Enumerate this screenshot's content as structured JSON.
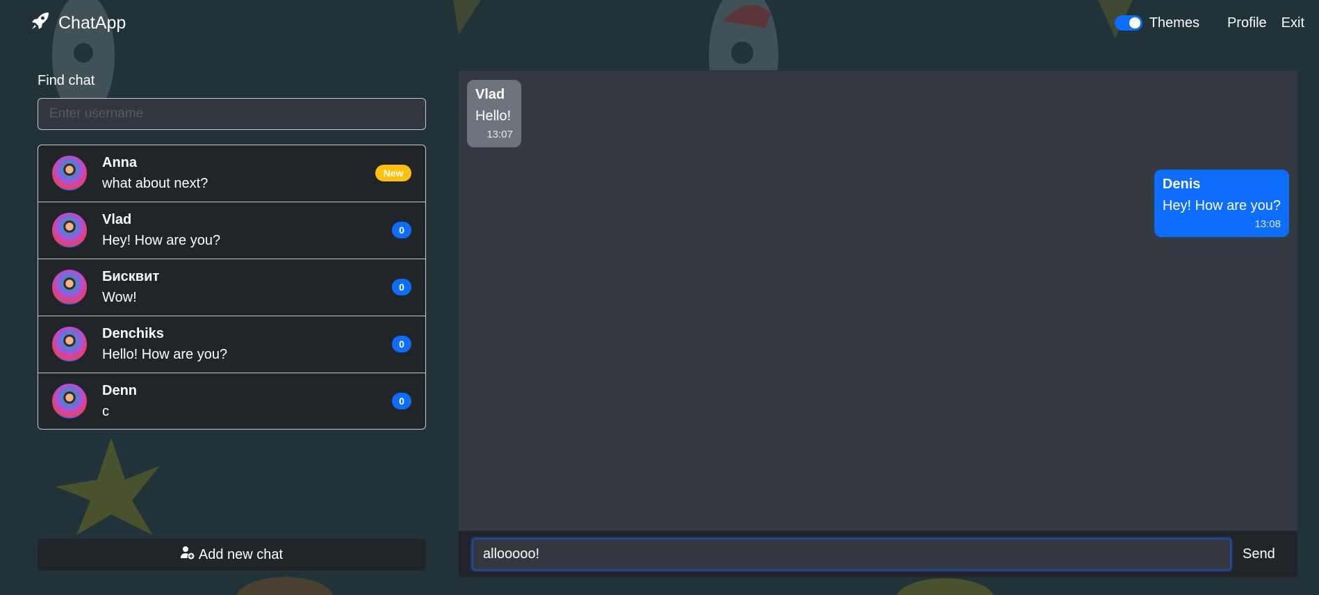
{
  "app": {
    "title": "ChatApp",
    "logo_icon": "rocket-icon"
  },
  "nav": {
    "themes_label": "Themes",
    "themes_on": true,
    "profile_label": "Profile",
    "exit_label": "Exit"
  },
  "sidebar": {
    "find_label": "Find chat",
    "search_placeholder": "Enter username",
    "chats": [
      {
        "name": "Anna",
        "preview": "what about next?",
        "badge": "New",
        "badge_type": "new"
      },
      {
        "name": "Vlad",
        "preview": "Hey! How are you?",
        "badge": "0",
        "badge_type": "count"
      },
      {
        "name": "Бисквит",
        "preview": "Wow!",
        "badge": "0",
        "badge_type": "count"
      },
      {
        "name": "Denchiks",
        "preview": "Hello! How are you?",
        "badge": "0",
        "badge_type": "count"
      },
      {
        "name": "Denn",
        "preview": "c",
        "badge": "0",
        "badge_type": "count"
      }
    ],
    "add_chat_label": "Add new chat"
  },
  "conversation": {
    "messages": [
      {
        "author": "Vlad",
        "text": "Hello!",
        "time": "13:07",
        "direction": "incoming"
      },
      {
        "author": "Denis",
        "text": "Hey! How are you?",
        "time": "13:08",
        "direction": "outgoing"
      }
    ],
    "input_value": "allooooo!",
    "send_label": "Send"
  },
  "colors": {
    "accent": "#0d6efd",
    "new_badge": "#ffc107",
    "background": "#1f3339",
    "panel": "#212529",
    "chat_bg": "#343a40",
    "incoming_bubble": "#6c757d"
  }
}
